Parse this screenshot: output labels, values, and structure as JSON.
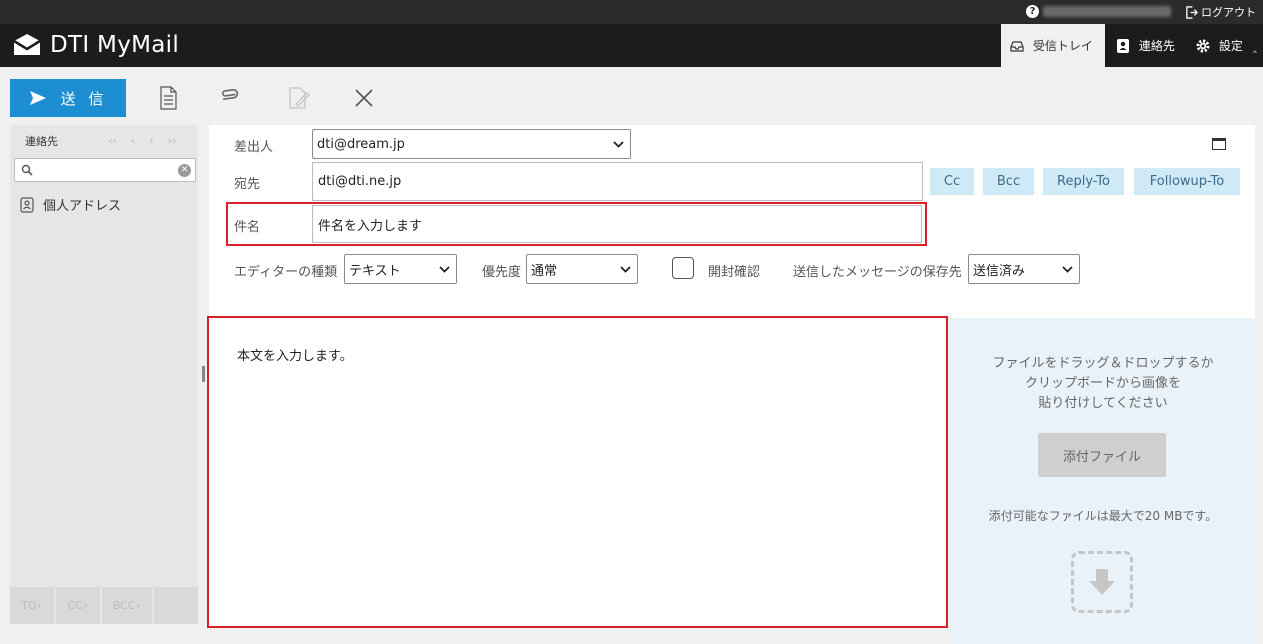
{
  "topbar": {
    "help_icon": "?",
    "logout_label": "ログアウト"
  },
  "header": {
    "app_title": "DTI MyMail",
    "nav": [
      {
        "label": "受信トレイ",
        "icon": "inbox-icon",
        "active": true
      },
      {
        "label": "連絡先",
        "icon": "contact-icon",
        "active": false
      },
      {
        "label": "設定",
        "icon": "gear-icon",
        "active": false
      }
    ]
  },
  "toolbar": {
    "send_label": "送 信",
    "icons": [
      "document-icon",
      "paperclip-icon",
      "edit-icon",
      "close-icon"
    ]
  },
  "sidebar": {
    "title": "連絡先",
    "search_placeholder": "",
    "address_book": "個人アドレス",
    "bottom_buttons": [
      "TO",
      "CC",
      "BCC"
    ],
    "bottom_sup": "+"
  },
  "compose": {
    "from_label": "差出人",
    "from_value": "dti@dream.jp",
    "to_label": "宛先",
    "to_value": "dti@dti.ne.jp",
    "subject_label": "件名",
    "subject_value": "件名を入力します",
    "cc_label": "Cc",
    "bcc_label": "Bcc",
    "replyto_label": "Reply-To",
    "followupto_label": "Followup-To",
    "editor_label": "エディターの種類",
    "editor_value": "テキスト",
    "priority_label": "優先度",
    "priority_value": "通常",
    "receipt_label": "開封確認",
    "save_label": "送信したメッセージの保存先",
    "save_value": "送信済み",
    "body": "本文を入力します。"
  },
  "attachment": {
    "message_lines": [
      "ファイルをドラッグ＆ドロップするか",
      "クリップボードから画像を",
      "貼り付けしてください"
    ],
    "button_label": "添付ファイル",
    "limit_text": "添付可能なファイルは最大で20 MBです。"
  },
  "colors": {
    "accent": "#1d8ed1",
    "highlight_border": "#d6202a",
    "header_bg": "#1c1c1c",
    "pill_bg": "#cfe9f7"
  }
}
